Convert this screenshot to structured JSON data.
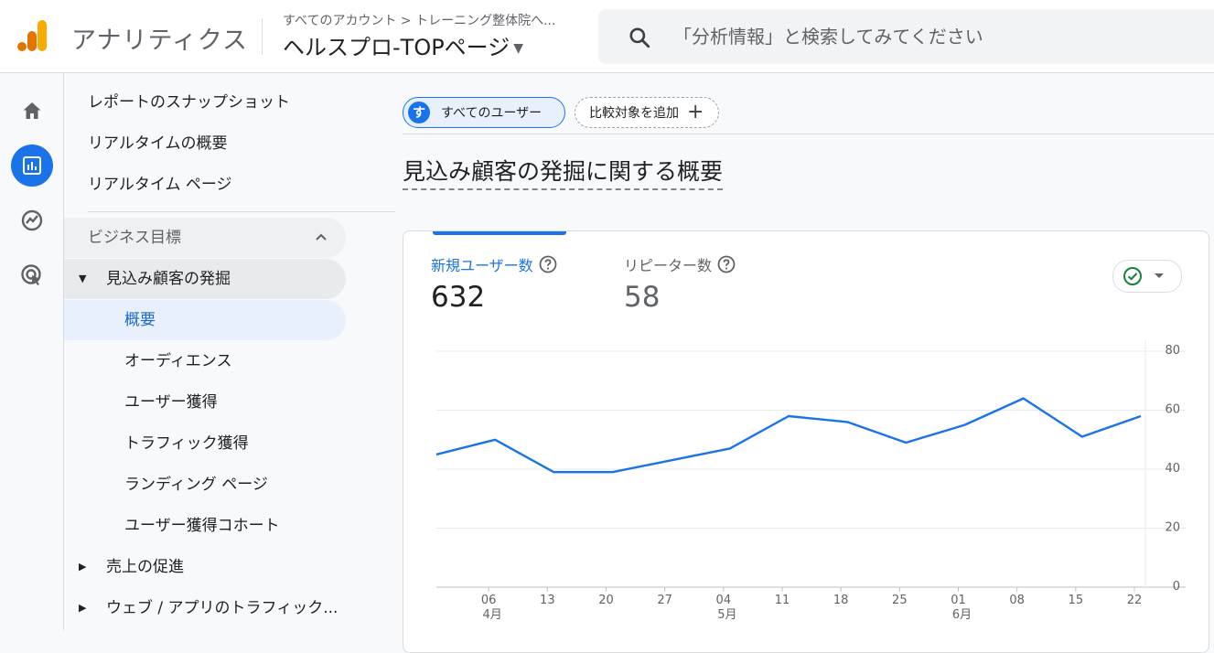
{
  "header": {
    "app_title": "アナリティクス",
    "breadcrumb": "すべてのアカウント > トレーニング整体院へ...",
    "property": "ヘルスプロ-TOPページ",
    "search_placeholder": "「分析情報」と検索してみてください"
  },
  "rail": {
    "items": [
      {
        "icon": "home-icon"
      },
      {
        "icon": "reports-icon",
        "active": true
      },
      {
        "icon": "explore-icon"
      },
      {
        "icon": "advertising-icon"
      }
    ]
  },
  "sidebar": {
    "items": [
      {
        "label": "レポートのスナップショット"
      },
      {
        "label": "リアルタイムの概要"
      },
      {
        "label": "リアルタイム ページ"
      }
    ],
    "group": {
      "label": "ビジネス目標"
    },
    "sub_open": {
      "label": "見込み顧客の発掘"
    },
    "sub_items": [
      {
        "label": "概要",
        "selected": true
      },
      {
        "label": "オーディエンス"
      },
      {
        "label": "ユーザー獲得"
      },
      {
        "label": "トラフィック獲得"
      },
      {
        "label": "ランディング ページ"
      },
      {
        "label": "ユーザー獲得コホート"
      }
    ],
    "collapsed": [
      {
        "label": "売上の促進"
      },
      {
        "label": "ウェブ / アプリのトラフィック..."
      }
    ]
  },
  "main": {
    "chip_avatar": "す",
    "chip_users": "すべてのユーザー",
    "chip_compare": "比較対象を追加",
    "title": "見込み顧客の発掘に関する概要"
  },
  "card": {
    "metrics": [
      {
        "label": "新規ユーザー数",
        "value": "632"
      },
      {
        "label": "リピーター数",
        "value": "58"
      }
    ]
  },
  "colors": {
    "accent": "#1a73e8",
    "line": "#1a73e8",
    "check": "#188038"
  },
  "chart_data": {
    "type": "line",
    "series": [
      {
        "values": [
          45,
          50,
          39,
          39,
          43,
          47,
          58,
          56,
          49,
          55,
          64,
          51,
          58
        ]
      }
    ],
    "x_ticks": [
      "06",
      "13",
      "20",
      "27",
      "04",
      "11",
      "18",
      "25",
      "01",
      "08",
      "15",
      "22"
    ],
    "x_months": [
      "4月",
      "5月",
      "6月"
    ],
    "y_ticks": [
      "80",
      "60",
      "40",
      "20",
      "0"
    ],
    "ylim": [
      0,
      80
    ],
    "grid": true
  }
}
